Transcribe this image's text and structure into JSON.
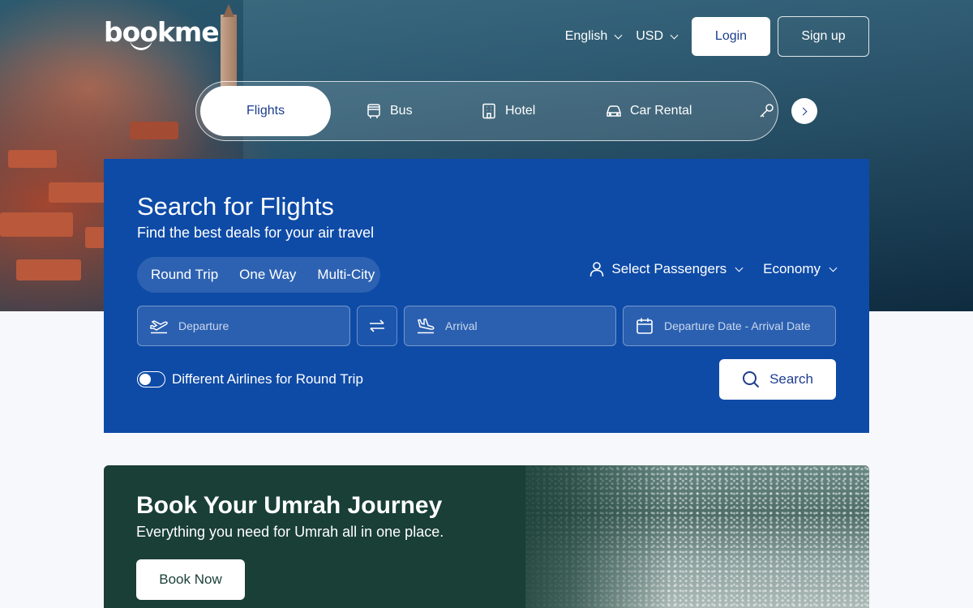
{
  "header": {
    "logo_text": "bookme",
    "language": "English",
    "currency": "USD",
    "login_label": "Login",
    "signup_label": "Sign up"
  },
  "tabs": [
    {
      "label": "Flights",
      "icon": "plane-icon",
      "active": true
    },
    {
      "label": "Bus",
      "icon": "bus-icon",
      "active": false
    },
    {
      "label": "Hotel",
      "icon": "hotel-icon",
      "active": false
    },
    {
      "label": "Car Rental",
      "icon": "car-icon",
      "active": false
    },
    {
      "label": "",
      "icon": "key-icon",
      "active": false
    }
  ],
  "search": {
    "title": "Search for Flights",
    "subtitle": "Find the best deals for your air travel",
    "trip_types": [
      "Round Trip",
      "One Way",
      "Multi-City"
    ],
    "passengers_label": "Select Passengers",
    "cabin_class": "Economy",
    "departure_placeholder": "Departure",
    "arrival_placeholder": "Arrival",
    "dates_placeholder": "Departure Date - Arrival Date",
    "different_airlines_label": "Different Airlines for Round Trip",
    "different_airlines_on": false,
    "search_label": "Search"
  },
  "umrah": {
    "title": "Book Your Umrah Journey",
    "subtitle": "Everything you need for Umrah all in one place.",
    "book_label": "Book Now"
  },
  "colors": {
    "brand_blue": "#0e4ba7",
    "umrah_green": "#193f36",
    "accent_text": "#1d3d8f"
  }
}
